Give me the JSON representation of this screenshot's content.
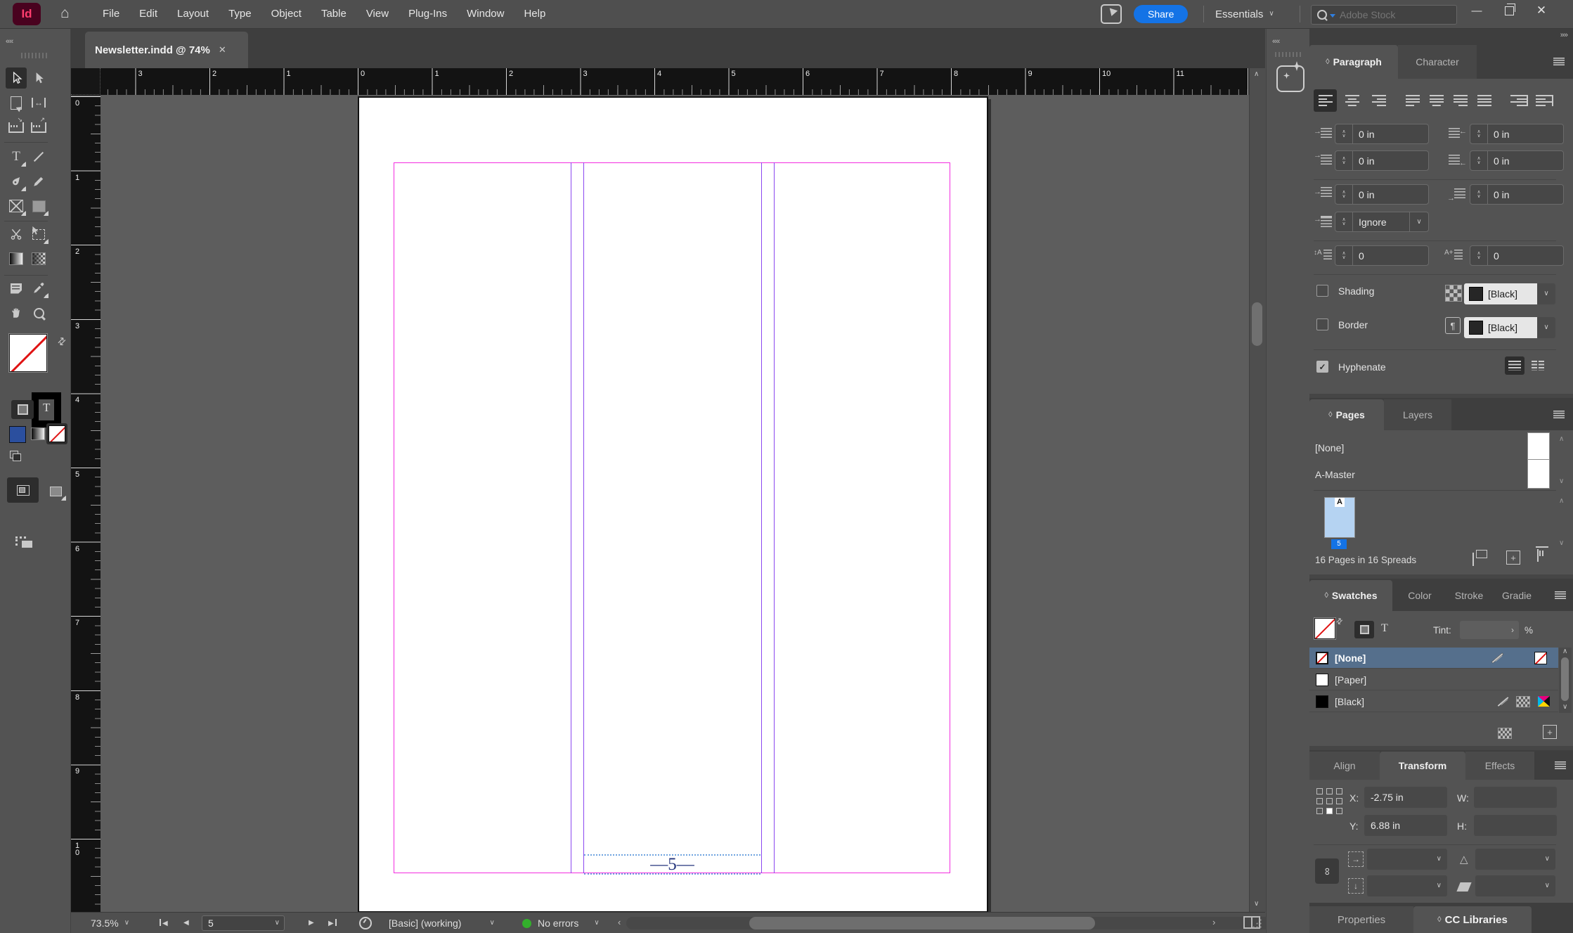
{
  "appbar": {
    "logo": "Id",
    "menu": [
      "File",
      "Edit",
      "Layout",
      "Type",
      "Object",
      "Table",
      "View",
      "Plug-Ins",
      "Window",
      "Help"
    ],
    "share": "Share",
    "workspace": "Essentials",
    "search_placeholder": "Adobe Stock"
  },
  "document_tab": {
    "title": "Newsletter.indd @ 74%",
    "close": "✕"
  },
  "rulers": {
    "horizontal": [
      "3",
      "2",
      "1",
      "0",
      "1",
      "2",
      "3",
      "4",
      "5",
      "6",
      "7",
      "8",
      "9",
      "10",
      "11"
    ],
    "vertical": [
      "0",
      "1",
      "2",
      "3",
      "4",
      "5",
      "6",
      "7",
      "8",
      "9",
      "10"
    ]
  },
  "page": {
    "footer_text": "—5—"
  },
  "paragraph": {
    "tab_active": "Paragraph",
    "tab_inactive": "Character",
    "fields": {
      "left_indent": "0 in",
      "right_indent": "0 in",
      "first_line_indent": "0 in",
      "last_line_right_indent": "0 in",
      "space_before": "0 in",
      "space_after": "0 in",
      "align_to_grid": "Ignore",
      "drop_cap_lines": "0",
      "drop_cap_chars": "0"
    },
    "shading": {
      "label": "Shading",
      "swatch": "[Black]"
    },
    "border": {
      "label": "Border",
      "swatch": "[Black]"
    },
    "hyphenate_label": "Hyphenate"
  },
  "pages": {
    "tab_active": "Pages",
    "tab_inactive": "Layers",
    "masters": [
      "[None]",
      "A-Master"
    ],
    "page_badge": "A",
    "page_label": "5",
    "footer": "16 Pages in 16 Spreads"
  },
  "swatches": {
    "tabs": [
      "Swatches",
      "Color",
      "Stroke",
      "Gradie"
    ],
    "tint_label": "Tint:",
    "percent": "%",
    "rows": [
      {
        "name": "[None]"
      },
      {
        "name": "[Paper]"
      },
      {
        "name": "[Black]"
      }
    ]
  },
  "transform": {
    "tabs": [
      "Align",
      "Transform",
      "Effects"
    ],
    "x_label": "X:",
    "x_value": "-2.75 in",
    "y_label": "Y:",
    "y_value": "6.88 in",
    "w_label": "W:",
    "h_label": "H:"
  },
  "dock_bottom": {
    "properties": "Properties",
    "cc_libraries": "CC Libraries"
  },
  "status": {
    "zoom": "73.5%",
    "page_field": "5",
    "preset": "[Basic] (working)",
    "errors": "No errors"
  },
  "colors": {
    "accent": "#1473e6",
    "margin_guide": "#f32ce0",
    "column_guide": "#8b47f0",
    "selection_blue": "#556f8c",
    "logo_bg": "#49021f",
    "logo_fg": "#ff3d6e",
    "ok_green": "#33b02c",
    "page_thumb_blue": "#b5d3f2",
    "footer_text_color": "#24357c"
  }
}
